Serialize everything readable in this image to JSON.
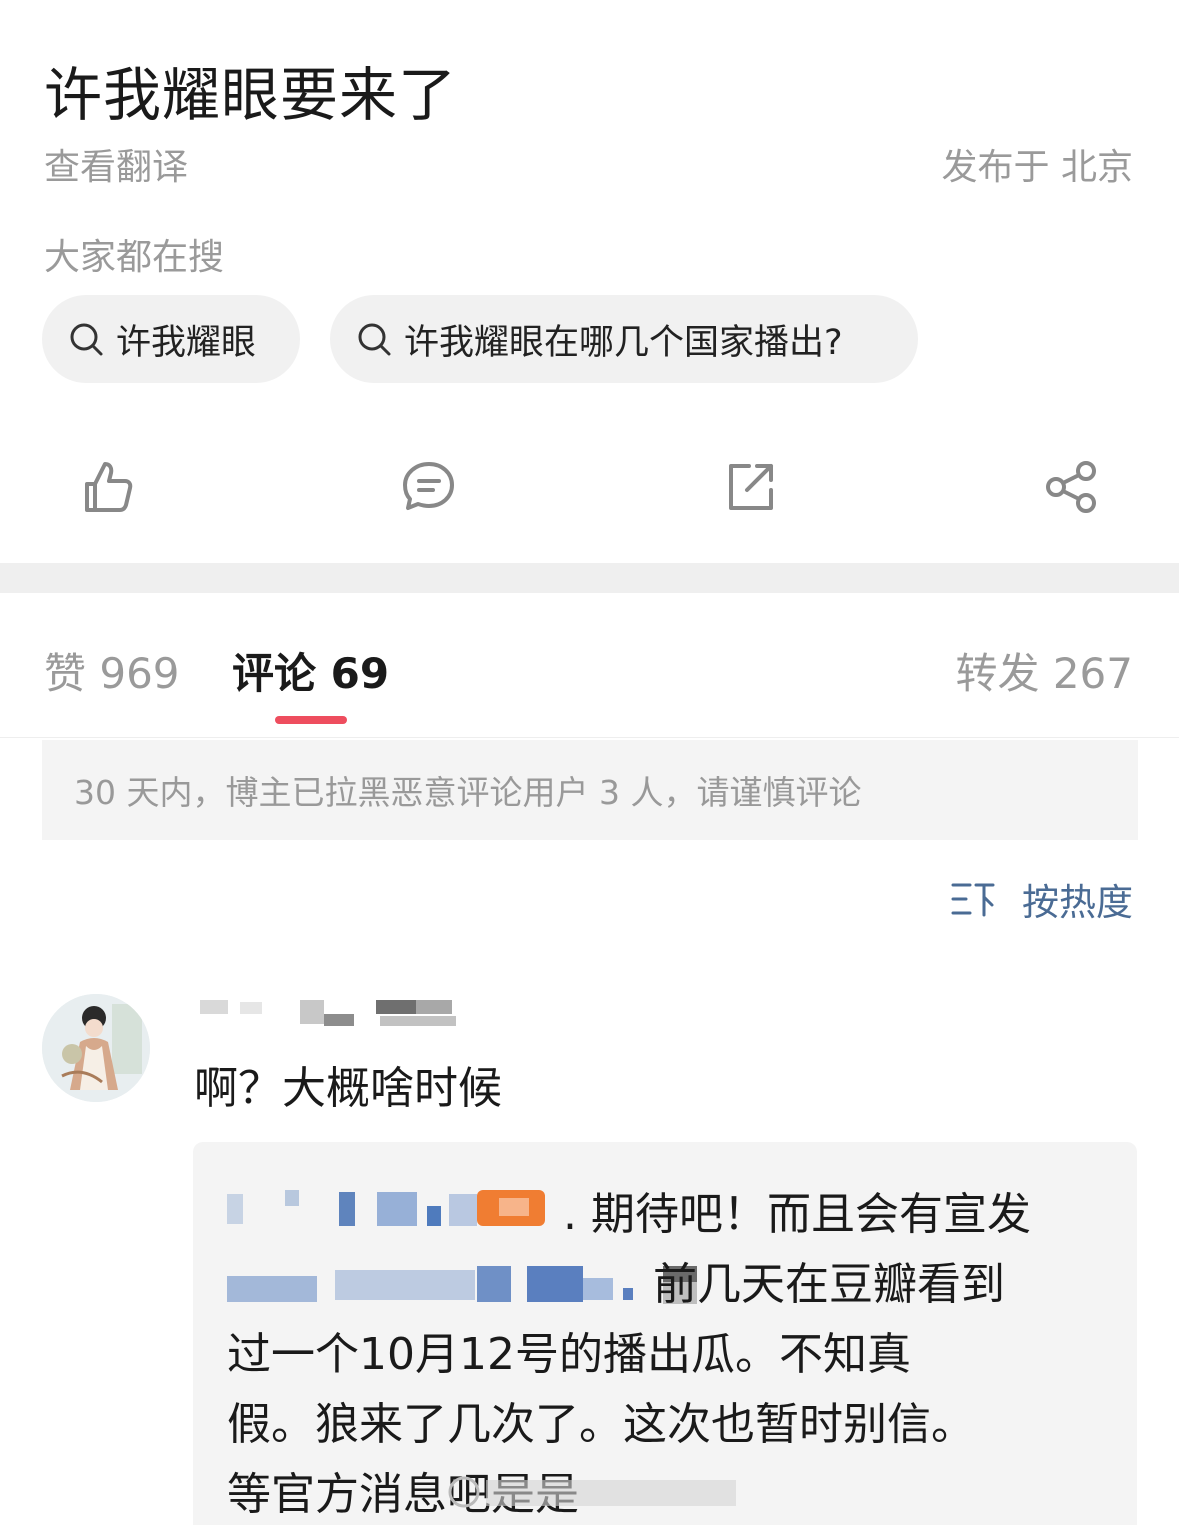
{
  "post": {
    "title": "许我耀眼要来了",
    "translate": "查看翻译",
    "location": "发布于 北京"
  },
  "hot_search": {
    "label": "大家都在搜",
    "chips": [
      {
        "text": "许我耀眼",
        "icon": "search-icon"
      },
      {
        "text": "许我耀眼在哪几个国家播出?",
        "icon": "search-icon"
      }
    ]
  },
  "actions": [
    {
      "name": "like",
      "icon": "thumbs-up-icon"
    },
    {
      "name": "comment",
      "icon": "comment-bubble-icon"
    },
    {
      "name": "repost",
      "icon": "repost-icon"
    },
    {
      "name": "share",
      "icon": "share-icon"
    }
  ],
  "tabs": {
    "like": "赞 969",
    "comment": "评论 69",
    "repost": "转发 267"
  },
  "notice": "30 天内，博主已拉黑恶意评论用户 3 人，请谨慎评论",
  "sort": {
    "label": "按热度",
    "icon": "sort-icon"
  },
  "comment": {
    "text": "啊？大概啥时候",
    "reply_lines": [
      ". 期待吧！而且会有宣发",
      "前几天在豆瓣看到",
      "过一个10月12号的播出瓜。不知真",
      "假。狼来了几次了。这次也暂时别信。",
      "等官方消息吧是是"
    ]
  },
  "colors": {
    "accent": "#ee4d5e",
    "link": "#4a6b94",
    "muted": "#9a9a9a"
  }
}
